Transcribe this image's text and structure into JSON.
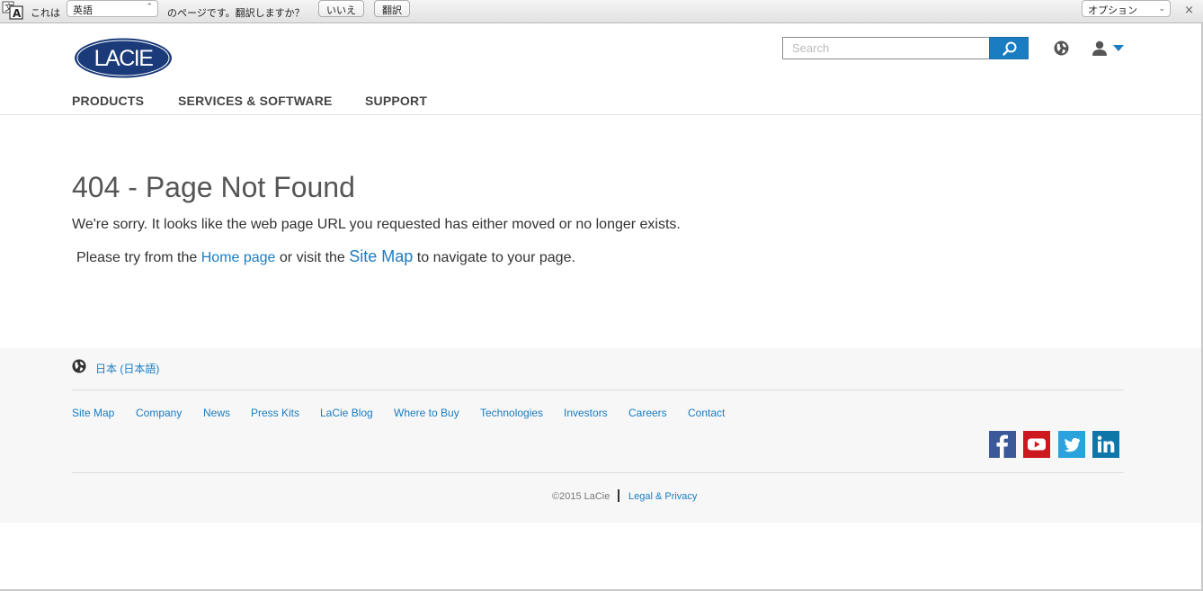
{
  "translate_bar": {
    "prefix": "これは",
    "language": "英語",
    "suffix": "のページです。翻訳しますか？",
    "no_label": "いいえ",
    "translate_label": "翻訳",
    "options_label": "オプション",
    "close_glyph": "×"
  },
  "header": {
    "logo_text": "LACIE",
    "search_placeholder": "Search",
    "nav": [
      "PRODUCTS",
      "SERVICES & SOFTWARE",
      "SUPPORT"
    ]
  },
  "main": {
    "title": "404 - Page Not Found",
    "message": "We're sorry. It looks like the web page URL you requested has either moved or no longer exists.",
    "try_prefix": "Please try from the",
    "home_link": "Home page",
    "try_middle": "or visit the",
    "sitemap_link": "Site Map",
    "try_suffix": "to navigate to your page."
  },
  "footer": {
    "language": "日本 (日本語)",
    "links": [
      "Site Map",
      "Company",
      "News",
      "Press Kits",
      "LaCie Blog",
      "Where to Buy",
      "Technologies",
      "Investors",
      "Careers",
      "Contact"
    ],
    "social": [
      "facebook-icon",
      "youtube-icon",
      "twitter-icon",
      "linkedin-icon"
    ],
    "copyright": "©2015 LaCie",
    "legal": "Legal & Privacy"
  },
  "colors": {
    "accent": "#1a7cc1",
    "logo": "#1a3a7a",
    "facebook": "#3b5998",
    "youtube": "#cc181e",
    "twitter": "#2aa3dc",
    "linkedin": "#0e76a8"
  }
}
